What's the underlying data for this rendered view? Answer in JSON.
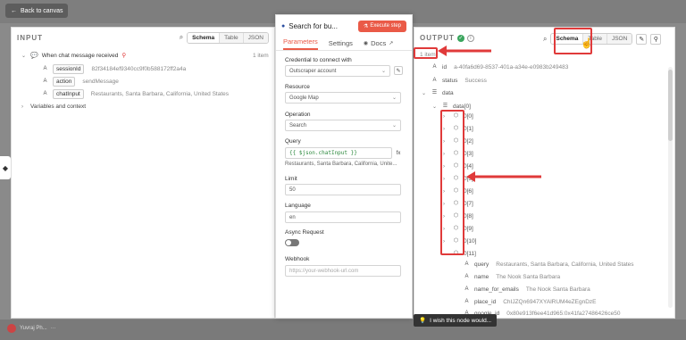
{
  "topbar": {
    "back_label": "Back to canvas"
  },
  "input": {
    "title": "INPUT",
    "view_tabs": [
      "Schema",
      "Table",
      "JSON"
    ],
    "active_view": "Schema",
    "trigger_label": "When chat message received",
    "item_count": "1 item",
    "fields": [
      {
        "type": "A",
        "key": "sessionId",
        "value": "82f34184ef9340cc9f0b588172ff2a4a"
      },
      {
        "type": "A",
        "key": "action",
        "value": "sendMessage"
      },
      {
        "type": "A",
        "key": "chatInput",
        "value": "Restaurants, Santa Barbara, California, United States"
      }
    ],
    "variables_label": "Variables and context"
  },
  "node": {
    "title": "Search for bu...",
    "execute_label": "Execute step",
    "tabs": [
      "Parameters",
      "Settings",
      "Docs"
    ],
    "active_tab": "Parameters",
    "credential_label": "Credential to connect with",
    "credential_value": "Outscraper account",
    "resource_label": "Resource",
    "resource_value": "Google Map",
    "operation_label": "Operation",
    "operation_value": "Search",
    "query_label": "Query",
    "query_expr": "{{ $json.chatInput }}",
    "query_preview": "Restaurants, Santa Barbara, California, Unite...",
    "limit_label": "Limit",
    "limit_value": "50",
    "language_label": "Language",
    "language_value": "en",
    "async_label": "Async Request",
    "async_on": false,
    "webhook_label": "Webhook",
    "webhook_placeholder": "https://your-webhook-url.com"
  },
  "output": {
    "title": "OUTPUT",
    "view_tabs": [
      "Schema",
      "Table",
      "JSON"
    ],
    "active_view": "Schema",
    "item_count": "1 item",
    "top_fields": [
      {
        "type": "A",
        "key": "id",
        "value": "a-40fa6d69-8537-401a-a34e-e0983b249483"
      },
      {
        "type": "A",
        "key": "status",
        "value": "Success"
      }
    ],
    "data_key": "data",
    "data0_key": "data[0]",
    "array_items": [
      "0[0]",
      "0[1]",
      "0[2]",
      "0[3]",
      "0[4]",
      "0[5]",
      "0[6]",
      "0[7]",
      "0[8]",
      "0[9]",
      "0[10]",
      "0[11]"
    ],
    "expanded_fields": [
      {
        "type": "A",
        "key": "query",
        "value": "Restaurants, Santa Barbara, California, United States"
      },
      {
        "type": "A",
        "key": "name",
        "value": "The Nook Santa Barbara"
      },
      {
        "type": "A",
        "key": "name_for_emails",
        "value": "The Nook Santa Barbara"
      },
      {
        "type": "A",
        "key": "place_id",
        "value": "ChIJZQn6947XYAlRUM4eZEgnDzE"
      },
      {
        "type": "A",
        "key": "google_id",
        "value": "0x80e913f6ee41d965:0x41fa27486426ce50"
      }
    ]
  },
  "tooltip": {
    "label": "I wish this node would..."
  },
  "bottom": {
    "user_label": "Yuvraj Ph..."
  },
  "colors": {
    "accent": "#ea5a47",
    "annotation_red": "#e03a3a",
    "success": "#3aa55d"
  }
}
